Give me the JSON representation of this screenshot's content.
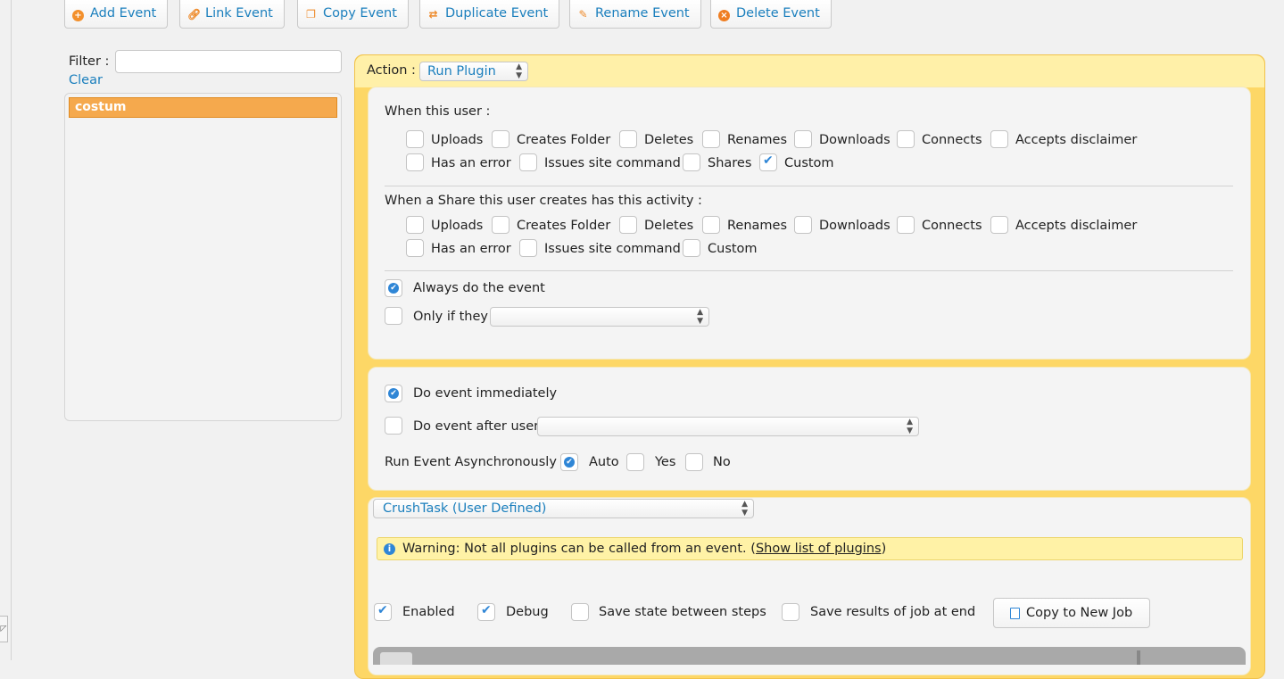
{
  "toolbar": {
    "add_event": "Add Event",
    "link_event": "Link Event",
    "copy_event": "Copy Event",
    "duplicate_event": "Duplicate Event",
    "rename_event": "Rename Event",
    "delete_event": "Delete Event"
  },
  "left": {
    "filter_label": "Filter :",
    "filter_value": "",
    "clear": "Clear",
    "events": [
      "costum"
    ]
  },
  "action": {
    "label": "Action :",
    "value": "Run Plugin"
  },
  "when_user": {
    "title": "When this user :",
    "row1": [
      {
        "label": "Uploads",
        "checked": false
      },
      {
        "label": "Creates Folder",
        "checked": false
      },
      {
        "label": "Deletes",
        "checked": false
      },
      {
        "label": "Renames",
        "checked": false
      },
      {
        "label": "Downloads",
        "checked": false
      },
      {
        "label": "Connects",
        "checked": false
      },
      {
        "label": "Accepts disclaimer",
        "checked": false
      }
    ],
    "row2": [
      {
        "label": "Has an error",
        "checked": false
      },
      {
        "label": "Issues site command",
        "checked": false
      },
      {
        "label": "Shares",
        "checked": false
      },
      {
        "label": "Custom",
        "checked": true
      }
    ]
  },
  "when_share": {
    "title": "When a Share this user creates has this activity :",
    "row1": [
      {
        "label": "Uploads",
        "checked": false
      },
      {
        "label": "Creates Folder",
        "checked": false
      },
      {
        "label": "Deletes",
        "checked": false
      },
      {
        "label": "Renames",
        "checked": false
      },
      {
        "label": "Downloads",
        "checked": false
      },
      {
        "label": "Connects",
        "checked": false
      },
      {
        "label": "Accepts disclaimer",
        "checked": false
      }
    ],
    "row2": [
      {
        "label": "Has an error",
        "checked": false
      },
      {
        "label": "Issues site command",
        "checked": false
      },
      {
        "label": "Custom",
        "checked": false
      }
    ]
  },
  "condition": {
    "always": "Always do the event",
    "only_if": "Only if they",
    "only_if_value": ""
  },
  "timing": {
    "immediately": "Do event immediately",
    "after_user": "Do event after user",
    "after_user_value": "",
    "async_label": "Run Event Asynchronously :",
    "async_options": [
      "Auto",
      "Yes",
      "No"
    ],
    "async_selected": "Auto"
  },
  "plugin": {
    "select_value": "CrushTask (User Defined)",
    "warning_text": "Warning: Not all plugins can be called from an event. (",
    "warning_link": "Show list of plugins",
    "warning_end": ")",
    "enabled": "Enabled",
    "debug": "Debug",
    "save_state": "Save state between steps",
    "save_results": "Save results of job at end",
    "copy_job": "Copy to New Job"
  },
  "icons": {
    "add": "plus-circle-icon",
    "link": "link-icon",
    "copy": "copy-icon",
    "duplicate": "duplicate-icon",
    "rename": "pencil-icon",
    "delete": "close-circle-icon",
    "info": "info-icon",
    "document": "document-icon"
  },
  "colors": {
    "accent_blue": "#1b7fbd",
    "selected_event": "#f5a94d",
    "panel_yellow": "#fdd766",
    "warning_bg": "#fff2a6"
  }
}
